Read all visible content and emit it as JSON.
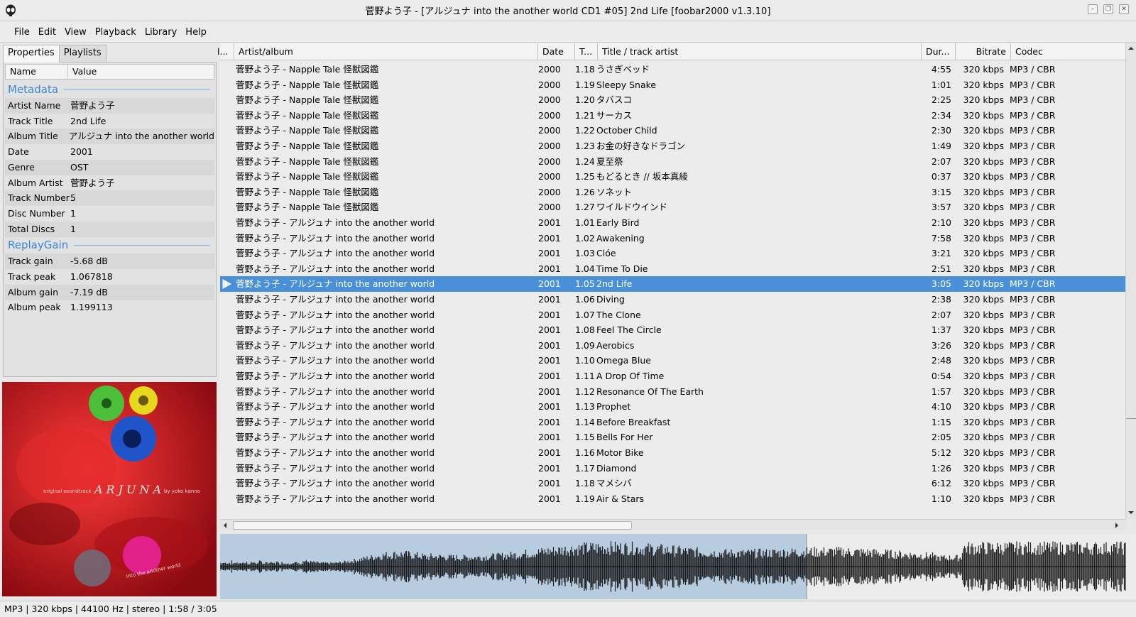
{
  "window": {
    "title": "菅野よう子 - [アルジュナ into the another world CD1 #05] 2nd Life   [foobar2000 v1.3.10]"
  },
  "menu": [
    "File",
    "Edit",
    "View",
    "Playback",
    "Library",
    "Help"
  ],
  "toolbar": [
    "stop-icon",
    "play-icon",
    "pause-icon",
    "previous-icon",
    "next-icon",
    "random-icon"
  ],
  "tabs": {
    "properties": "Properties",
    "playlists": "Playlists"
  },
  "properties": {
    "headers": {
      "name": "Name",
      "value": "Value"
    },
    "metadata_title": "Metadata",
    "metadata": [
      {
        "k": "Artist Name",
        "v": "菅野よう子"
      },
      {
        "k": "Track Title",
        "v": "2nd Life"
      },
      {
        "k": "Album Title",
        "v": "アルジュナ into the another world"
      },
      {
        "k": "Date",
        "v": "2001"
      },
      {
        "k": "Genre",
        "v": "OST"
      },
      {
        "k": "Album Artist",
        "v": "菅野よう子"
      },
      {
        "k": "Track Number",
        "v": "5"
      },
      {
        "k": "Disc Number",
        "v": "1"
      },
      {
        "k": "Total Discs",
        "v": "1"
      }
    ],
    "replaygain_title": "ReplayGain",
    "replaygain": [
      {
        "k": "Track gain",
        "v": "-5.68 dB"
      },
      {
        "k": "Track peak",
        "v": "1.067818"
      },
      {
        "k": "Album gain",
        "v": "-7.19 dB"
      },
      {
        "k": "Album peak",
        "v": "1.199113"
      }
    ]
  },
  "album_art": {
    "text_left": "original soundtrack",
    "title": "ARJUNA",
    "by": "by yoko kanno",
    "bottom": "into the another world",
    "colors": {
      "bg": "#c0141e",
      "green": "#4bbf3a",
      "yellow": "#e6d81c",
      "blue": "#1f55c8",
      "pink": "#e2208a"
    }
  },
  "playlist": {
    "headers": {
      "playing": "l...",
      "artist_album": "Artist/album",
      "date": "Date",
      "track": "T...",
      "title": "Title / track artist",
      "duration": "Dur...",
      "bitrate": "Bitrate",
      "codec": "Codec"
    },
    "rows": [
      {
        "a": "菅野よう子 - Napple Tale 怪獣図鑑",
        "d": "2000",
        "n": "1.18",
        "t": "うさぎベッド",
        "du": "4:55",
        "b": "320 kbps",
        "c": "MP3 / CBR"
      },
      {
        "a": "菅野よう子 - Napple Tale 怪獣図鑑",
        "d": "2000",
        "n": "1.19",
        "t": "Sleepy Snake",
        "du": "1:01",
        "b": "320 kbps",
        "c": "MP3 / CBR"
      },
      {
        "a": "菅野よう子 - Napple Tale 怪獣図鑑",
        "d": "2000",
        "n": "1.20",
        "t": "タバスコ",
        "du": "2:25",
        "b": "320 kbps",
        "c": "MP3 / CBR"
      },
      {
        "a": "菅野よう子 - Napple Tale 怪獣図鑑",
        "d": "2000",
        "n": "1.21",
        "t": "サーカス",
        "du": "2:34",
        "b": "320 kbps",
        "c": "MP3 / CBR"
      },
      {
        "a": "菅野よう子 - Napple Tale 怪獣図鑑",
        "d": "2000",
        "n": "1.22",
        "t": "October Child",
        "du": "2:30",
        "b": "320 kbps",
        "c": "MP3 / CBR"
      },
      {
        "a": "菅野よう子 - Napple Tale 怪獣図鑑",
        "d": "2000",
        "n": "1.23",
        "t": "お金の好きなドラゴン",
        "du": "1:49",
        "b": "320 kbps",
        "c": "MP3 / CBR"
      },
      {
        "a": "菅野よう子 - Napple Tale 怪獣図鑑",
        "d": "2000",
        "n": "1.24",
        "t": "夏至祭",
        "du": "2:07",
        "b": "320 kbps",
        "c": "MP3 / CBR"
      },
      {
        "a": "菅野よう子 - Napple Tale 怪獣図鑑",
        "d": "2000",
        "n": "1.25",
        "t": "もどるとき // 坂本真綾",
        "du": "0:37",
        "b": "320 kbps",
        "c": "MP3 / CBR"
      },
      {
        "a": "菅野よう子 - Napple Tale 怪獣図鑑",
        "d": "2000",
        "n": "1.26",
        "t": "ソネット",
        "du": "3:15",
        "b": "320 kbps",
        "c": "MP3 / CBR"
      },
      {
        "a": "菅野よう子 - Napple Tale 怪獣図鑑",
        "d": "2000",
        "n": "1.27",
        "t": "ワイルドウインド",
        "du": "3:57",
        "b": "320 kbps",
        "c": "MP3 / CBR"
      },
      {
        "a": "菅野よう子 - アルジュナ into the another world",
        "d": "2001",
        "n": "1.01",
        "t": "Early Bird",
        "du": "2:10",
        "b": "320 kbps",
        "c": "MP3 / CBR"
      },
      {
        "a": "菅野よう子 - アルジュナ into the another world",
        "d": "2001",
        "n": "1.02",
        "t": "Awakening",
        "du": "7:58",
        "b": "320 kbps",
        "c": "MP3 / CBR"
      },
      {
        "a": "菅野よう子 - アルジュナ into the another world",
        "d": "2001",
        "n": "1.03",
        "t": "Clóe",
        "du": "3:21",
        "b": "320 kbps",
        "c": "MP3 / CBR"
      },
      {
        "a": "菅野よう子 - アルジュナ into the another world",
        "d": "2001",
        "n": "1.04",
        "t": "Time To Die",
        "du": "2:51",
        "b": "320 kbps",
        "c": "MP3 / CBR"
      },
      {
        "a": "菅野よう子 - アルジュナ into the another world",
        "d": "2001",
        "n": "1.05",
        "t": "2nd Life",
        "du": "3:05",
        "b": "320 kbps",
        "c": "MP3 / CBR",
        "playing": true
      },
      {
        "a": "菅野よう子 - アルジュナ into the another world",
        "d": "2001",
        "n": "1.06",
        "t": "Diving",
        "du": "2:38",
        "b": "320 kbps",
        "c": "MP3 / CBR"
      },
      {
        "a": "菅野よう子 - アルジュナ into the another world",
        "d": "2001",
        "n": "1.07",
        "t": "The Clone",
        "du": "2:07",
        "b": "320 kbps",
        "c": "MP3 / CBR"
      },
      {
        "a": "菅野よう子 - アルジュナ into the another world",
        "d": "2001",
        "n": "1.08",
        "t": "Feel The Circle",
        "du": "1:37",
        "b": "320 kbps",
        "c": "MP3 / CBR"
      },
      {
        "a": "菅野よう子 - アルジュナ into the another world",
        "d": "2001",
        "n": "1.09",
        "t": "Aerobics",
        "du": "3:26",
        "b": "320 kbps",
        "c": "MP3 / CBR"
      },
      {
        "a": "菅野よう子 - アルジュナ into the another world",
        "d": "2001",
        "n": "1.10",
        "t": "Omega Blue",
        "du": "2:48",
        "b": "320 kbps",
        "c": "MP3 / CBR"
      },
      {
        "a": "菅野よう子 - アルジュナ into the another world",
        "d": "2001",
        "n": "1.11",
        "t": "A Drop Of Time",
        "du": "0:54",
        "b": "320 kbps",
        "c": "MP3 / CBR"
      },
      {
        "a": "菅野よう子 - アルジュナ into the another world",
        "d": "2001",
        "n": "1.12",
        "t": "Resonance Of The Earth",
        "du": "1:57",
        "b": "320 kbps",
        "c": "MP3 / CBR"
      },
      {
        "a": "菅野よう子 - アルジュナ into the another world",
        "d": "2001",
        "n": "1.13",
        "t": "Prophet",
        "du": "4:10",
        "b": "320 kbps",
        "c": "MP3 / CBR"
      },
      {
        "a": "菅野よう子 - アルジュナ into the another world",
        "d": "2001",
        "n": "1.14",
        "t": "Before Breakfast",
        "du": "1:15",
        "b": "320 kbps",
        "c": "MP3 / CBR"
      },
      {
        "a": "菅野よう子 - アルジュナ into the another world",
        "d": "2001",
        "n": "1.15",
        "t": "Bells For Her",
        "du": "2:05",
        "b": "320 kbps",
        "c": "MP3 / CBR"
      },
      {
        "a": "菅野よう子 - アルジュナ into the another world",
        "d": "2001",
        "n": "1.16",
        "t": "Motor Bike",
        "du": "5:12",
        "b": "320 kbps",
        "c": "MP3 / CBR"
      },
      {
        "a": "菅野よう子 - アルジュナ into the another world",
        "d": "2001",
        "n": "1.17",
        "t": "Diamond",
        "du": "1:26",
        "b": "320 kbps",
        "c": "MP3 / CBR"
      },
      {
        "a": "菅野よう子 - アルジュナ into the another world",
        "d": "2001",
        "n": "1.18",
        "t": "マメシバ",
        "du": "6:12",
        "b": "320 kbps",
        "c": "MP3 / CBR"
      },
      {
        "a": "菅野よう子 - アルジュナ into the another world",
        "d": "2001",
        "n": "1.19",
        "t": "Air & Stars",
        "du": "1:10",
        "b": "320 kbps",
        "c": "MP3 / CBR"
      }
    ]
  },
  "seekbar": {
    "played_fraction": 0.64,
    "played_color": "#b8cce0",
    "wave_color": "#0d0d0d"
  },
  "status": "MP3 | 320 kbps | 44100 Hz | stereo | 1:58 / 3:05",
  "colors": {
    "accent": "#4a90d9",
    "section": "#3a86d6"
  }
}
